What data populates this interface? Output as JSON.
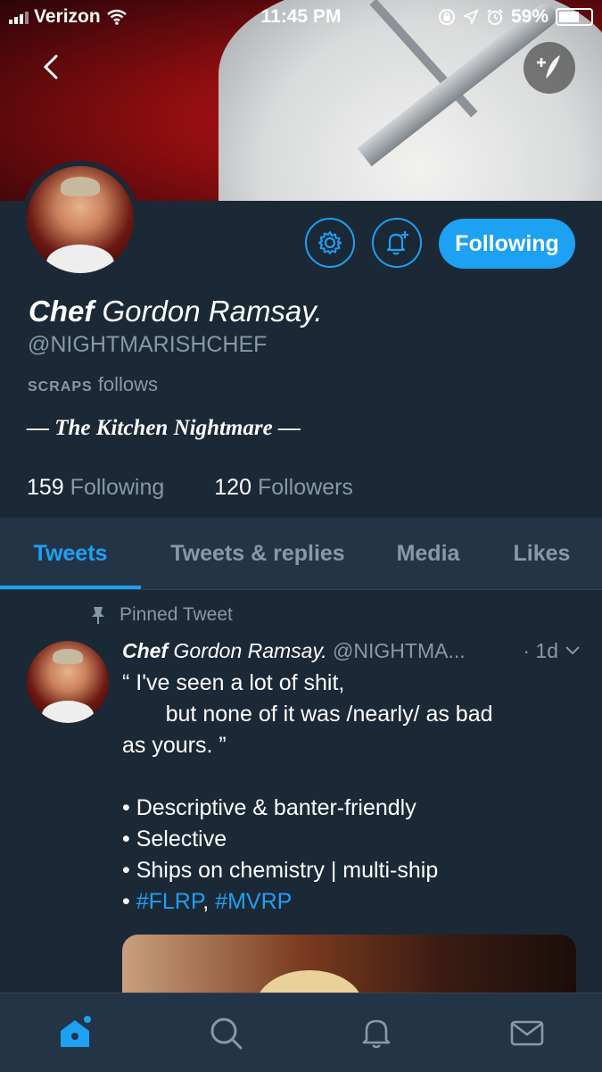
{
  "status_bar": {
    "carrier": "Verizon",
    "time": "11:45 PM",
    "battery": "59%",
    "battery_level": 0.59
  },
  "profile": {
    "name_prefix": "Chef",
    "name_rest": "Gordon Ramsay.",
    "handle": "@NIGHTMARISHCHEF",
    "follows_name": "SCRAPS",
    "follows_text": "follows",
    "bio": "— The Kitchen Nightmare —",
    "following_count": "159",
    "following_label": "Following",
    "followers_count": "120",
    "followers_label": "Followers",
    "follow_button": "Following"
  },
  "tabs": [
    {
      "label": "Tweets"
    },
    {
      "label": "Tweets & replies"
    },
    {
      "label": "Media"
    },
    {
      "label": "Likes"
    }
  ],
  "active_tab": "Tweets",
  "pinned_tweet": {
    "pinned_label": "Pinned Tweet",
    "author_prefix": "Chef",
    "author_rest": "Gordon Ramsay.",
    "handle": "@NIGHTMA...",
    "time": "· 1d",
    "lines": [
      "“ I've seen a lot of shit,",
      "       but none of it was /nearly/ as bad",
      "as yours. ”",
      "",
      "• Descriptive & banter-friendly",
      "• Selective",
      "• Ships on chemistry | multi-ship"
    ],
    "hashtag_bullet": "• ",
    "hashtag1": "#FLRP",
    "hashtag_sep": ", ",
    "hashtag2": "#MVRP"
  },
  "colors": {
    "accent": "#1da1f2",
    "background": "#1b2836",
    "secondary_text": "#8899a6"
  },
  "icons": {
    "back": "chevron-left-icon",
    "compose": "compose-icon",
    "settings": "gear-icon",
    "notify": "bell-plus-icon",
    "pin": "pin-icon",
    "home": "home-icon",
    "search": "search-icon",
    "notifications": "bell-icon",
    "messages": "mail-icon"
  }
}
